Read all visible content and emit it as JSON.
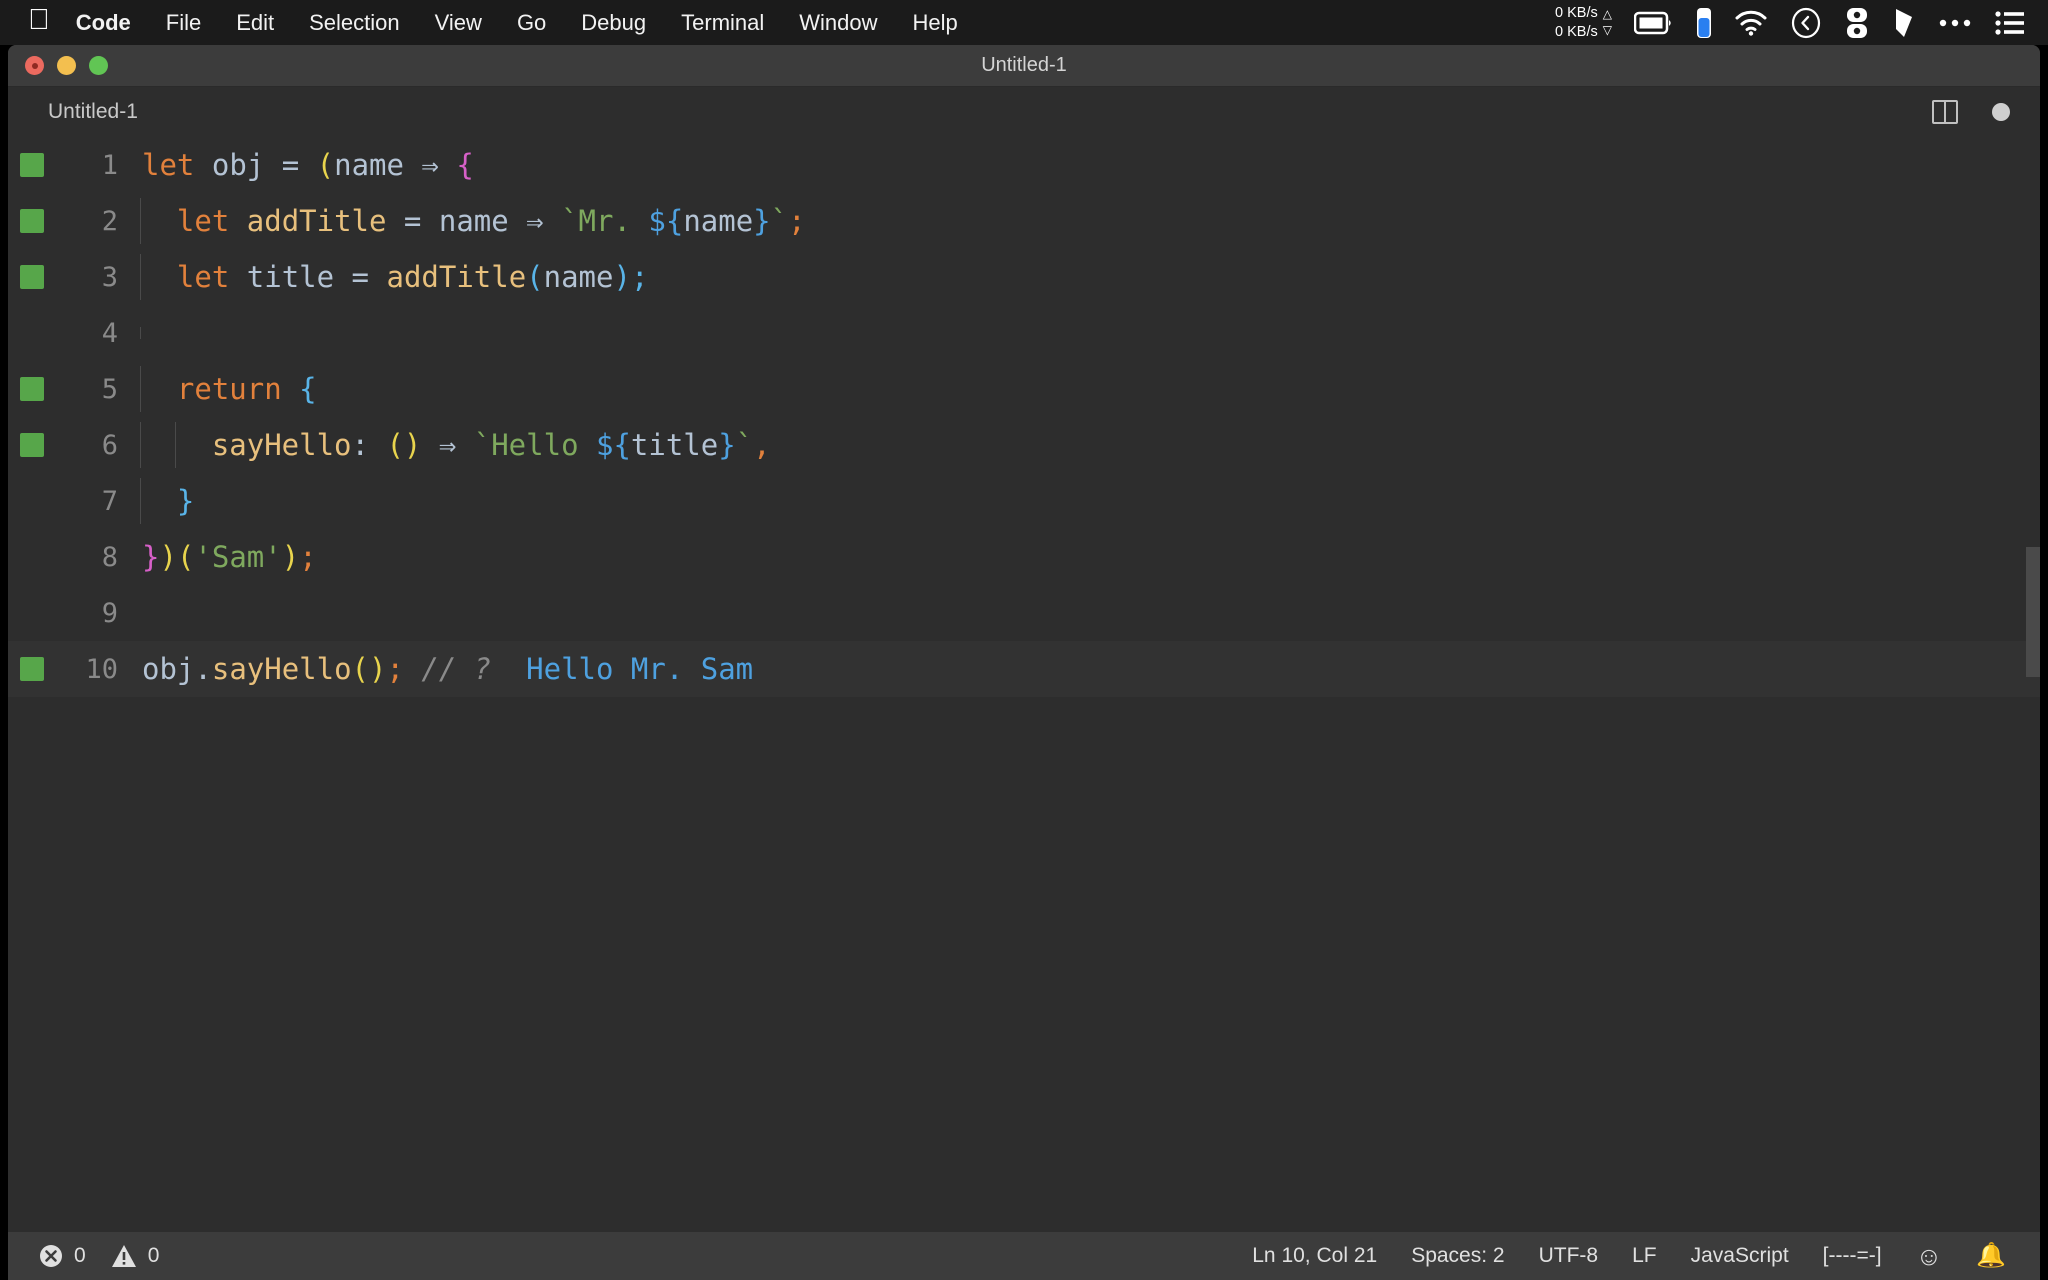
{
  "menubar": {
    "apple_icon": "apple-logo-icon",
    "items": [
      {
        "label": "Code",
        "bold": true
      },
      {
        "label": "File",
        "bold": false
      },
      {
        "label": "Edit",
        "bold": false
      },
      {
        "label": "Selection",
        "bold": false
      },
      {
        "label": "View",
        "bold": false
      },
      {
        "label": "Go",
        "bold": false
      },
      {
        "label": "Debug",
        "bold": false
      },
      {
        "label": "Terminal",
        "bold": false
      },
      {
        "label": "Window",
        "bold": false
      },
      {
        "label": "Help",
        "bold": false
      }
    ],
    "network": {
      "upload": "0 KB/s",
      "download": "0 KB/s",
      "up_arrow": "△",
      "down_arrow": "▽"
    },
    "status_icons": [
      "battery-icon",
      "battery-level-icon",
      "wifi-icon",
      "clock-icon",
      "toggl-icon",
      "dropbox-icon",
      "ellipsis-icon",
      "control-center-icon"
    ]
  },
  "window": {
    "title": "Untitled-1",
    "traffic_lights": [
      "close-button",
      "minimize-button",
      "maximize-button"
    ]
  },
  "tabbar": {
    "tab_label": "Untitled-1",
    "split_editor_label": "split-editor-icon",
    "dirty_indicator_label": "unsaved-dot-icon"
  },
  "editor": {
    "lines": [
      {
        "number": "1",
        "breakpoint": true,
        "current": false,
        "indent_guides": 0,
        "tokens": [
          {
            "text": "let",
            "cls": "t-kw"
          },
          {
            "text": " ",
            "cls": "t-op"
          },
          {
            "text": "obj",
            "cls": "t-var"
          },
          {
            "text": " = ",
            "cls": "t-op"
          },
          {
            "text": "(",
            "cls": "t-par-y"
          },
          {
            "text": "name",
            "cls": "t-var"
          },
          {
            "text": " ⇒ ",
            "cls": "t-op"
          },
          {
            "text": "{",
            "cls": "t-par-m"
          }
        ]
      },
      {
        "number": "2",
        "breakpoint": true,
        "current": false,
        "indent_guides": 1,
        "tokens": [
          {
            "text": "  ",
            "cls": "t-op"
          },
          {
            "text": "let",
            "cls": "t-kw"
          },
          {
            "text": " ",
            "cls": "t-op"
          },
          {
            "text": "addTitle",
            "cls": "t-fn"
          },
          {
            "text": " = ",
            "cls": "t-op"
          },
          {
            "text": "name",
            "cls": "t-var"
          },
          {
            "text": " ⇒ ",
            "cls": "t-op"
          },
          {
            "text": "`Mr. ",
            "cls": "t-str"
          },
          {
            "text": "${",
            "cls": "t-tpl"
          },
          {
            "text": "name",
            "cls": "t-var"
          },
          {
            "text": "}",
            "cls": "t-tpl"
          },
          {
            "text": "`",
            "cls": "t-str"
          },
          {
            "text": ";",
            "cls": "t-semi-o"
          }
        ]
      },
      {
        "number": "3",
        "breakpoint": true,
        "current": false,
        "indent_guides": 1,
        "tokens": [
          {
            "text": "  ",
            "cls": "t-op"
          },
          {
            "text": "let",
            "cls": "t-kw"
          },
          {
            "text": " ",
            "cls": "t-op"
          },
          {
            "text": "title",
            "cls": "t-var"
          },
          {
            "text": " = ",
            "cls": "t-op"
          },
          {
            "text": "addTitle",
            "cls": "t-fn"
          },
          {
            "text": "(",
            "cls": "t-par-b"
          },
          {
            "text": "name",
            "cls": "t-var"
          },
          {
            "text": ")",
            "cls": "t-par-b"
          },
          {
            "text": ";",
            "cls": "t-semi-b"
          }
        ]
      },
      {
        "number": "4",
        "breakpoint": false,
        "current": false,
        "indent_guides": 1,
        "tokens": []
      },
      {
        "number": "5",
        "breakpoint": true,
        "current": false,
        "indent_guides": 1,
        "tokens": [
          {
            "text": "  ",
            "cls": "t-op"
          },
          {
            "text": "return",
            "cls": "t-kw"
          },
          {
            "text": " ",
            "cls": "t-op"
          },
          {
            "text": "{",
            "cls": "t-par-b"
          }
        ]
      },
      {
        "number": "6",
        "breakpoint": true,
        "current": false,
        "indent_guides": 2,
        "tokens": [
          {
            "text": "    ",
            "cls": "t-op"
          },
          {
            "text": "sayHello",
            "cls": "t-fn"
          },
          {
            "text": ": ",
            "cls": "t-op"
          },
          {
            "text": "()",
            "cls": "t-par-y"
          },
          {
            "text": " ⇒ ",
            "cls": "t-op"
          },
          {
            "text": "`Hello ",
            "cls": "t-str"
          },
          {
            "text": "${",
            "cls": "t-tpl"
          },
          {
            "text": "title",
            "cls": "t-var"
          },
          {
            "text": "}",
            "cls": "t-tpl"
          },
          {
            "text": "`",
            "cls": "t-str"
          },
          {
            "text": ",",
            "cls": "t-semi-o"
          }
        ]
      },
      {
        "number": "7",
        "breakpoint": false,
        "current": false,
        "indent_guides": 1,
        "tokens": [
          {
            "text": "  ",
            "cls": "t-op"
          },
          {
            "text": "}",
            "cls": "t-par-b"
          }
        ]
      },
      {
        "number": "8",
        "breakpoint": false,
        "current": false,
        "indent_guides": 0,
        "tokens": [
          {
            "text": "}",
            "cls": "t-par-m"
          },
          {
            "text": ")",
            "cls": "t-par-y"
          },
          {
            "text": "(",
            "cls": "t-par-y"
          },
          {
            "text": "'Sam'",
            "cls": "t-str"
          },
          {
            "text": ")",
            "cls": "t-par-y"
          },
          {
            "text": ";",
            "cls": "t-semi-o"
          }
        ]
      },
      {
        "number": "9",
        "breakpoint": false,
        "current": false,
        "indent_guides": 0,
        "tokens": []
      },
      {
        "number": "10",
        "breakpoint": true,
        "current": true,
        "indent_guides": 0,
        "tokens": [
          {
            "text": "obj",
            "cls": "t-var"
          },
          {
            "text": ".",
            "cls": "t-op"
          },
          {
            "text": "sayHello",
            "cls": "t-fn"
          },
          {
            "text": "()",
            "cls": "t-par-y"
          },
          {
            "text": ";",
            "cls": "t-semi-o"
          },
          {
            "text": " // ? ",
            "cls": "t-comment"
          },
          {
            "text": " Hello Mr. Sam",
            "cls": "t-out"
          }
        ]
      }
    ]
  },
  "statusbar": {
    "error_icon": "error-circle-icon",
    "error_count": "0",
    "warning_icon": "warning-triangle-icon",
    "warning_count": "0",
    "cursor_position": "Ln 10, Col 21",
    "indentation": "Spaces: 2",
    "encoding": "UTF-8",
    "line_ending": "LF",
    "language_mode": "JavaScript",
    "extension_status": "[----=-]",
    "feedback_icon": "smiley-icon",
    "notifications_icon": "bell-icon"
  },
  "colors": {
    "editor_bg": "#2d2d2d",
    "titlebar_bg": "#3c3c3c",
    "statusbar_bg": "#3c3c3c",
    "menubar_bg": "#1b1b1b",
    "breakpoint_green": "#57a64a",
    "keyword_orange": "#e2813c",
    "string_green": "#7fa95e",
    "function_yellow": "#e8c07d",
    "template_blue": "#4ea1e0"
  }
}
